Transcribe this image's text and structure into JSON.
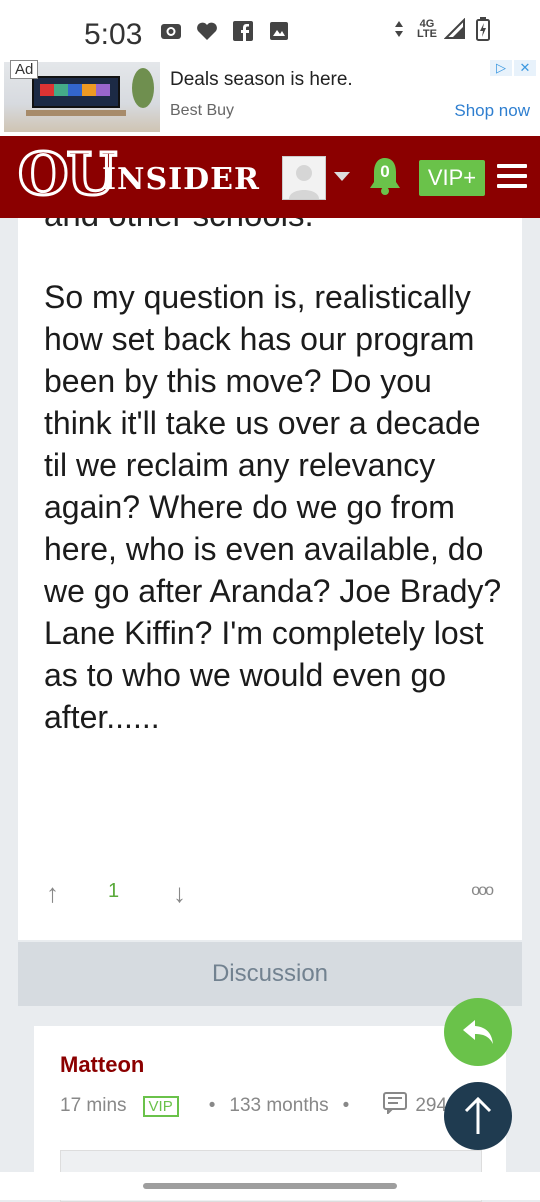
{
  "status_bar": {
    "time": "5:03",
    "network": "4G LTE",
    "left_icons": [
      "camera-icon",
      "heart-icon",
      "facebook-icon",
      "image-icon"
    ],
    "right_icons": [
      "data-arrows-icon",
      "signal-icon",
      "battery-charging-icon"
    ]
  },
  "ad": {
    "label": "Ad",
    "title": "Deals season is here.",
    "advertiser": "Best Buy",
    "cta": "Shop now"
  },
  "header": {
    "logo_ou": "OU",
    "logo_inside": "INSIDER",
    "notification_count": "0",
    "vip_label": "VIP+",
    "brand_color": "#8b0000",
    "accent_color": "#6ac24a"
  },
  "post": {
    "previous_line": "and other schools.",
    "body": "So my question is, realistically how set back has our program been by this move? Do you think it'll take us over a decade til we reclaim any relevancy again? Where do we go from here, who is even available, do we go after Aranda? Joe Brady? Lane Kiffin? I'm completely lost as to who we would even go after......",
    "vote_count": "1",
    "more_label": "ooo"
  },
  "discussion": {
    "label": "Discussion"
  },
  "comment": {
    "author": "Matteon",
    "time": "17 mins",
    "badge": "VIP",
    "tenure": "133 months",
    "post_count": "294"
  }
}
